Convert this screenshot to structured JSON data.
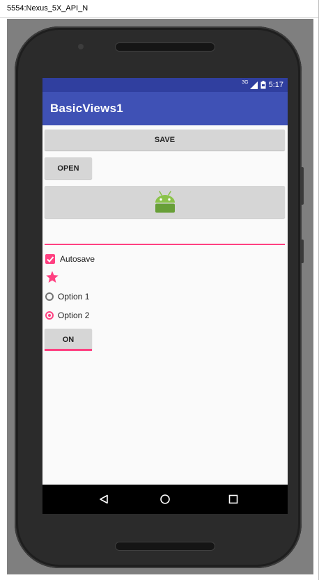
{
  "window": {
    "title": "5554:Nexus_5X_API_N"
  },
  "status_bar": {
    "network_label": "3G",
    "time": "5:17"
  },
  "app": {
    "title": "BasicViews1",
    "save_button_label": "SAVE",
    "open_button_label": "OPEN",
    "image_button_icon": "android-robot-icon",
    "edit_text_value": "",
    "checkbox": {
      "label": "Autosave",
      "checked": true
    },
    "star_icon": "star-icon",
    "radio_options": [
      {
        "label": "Option 1",
        "checked": false
      },
      {
        "label": "Option 2",
        "checked": true
      }
    ],
    "toggle_button_label": "ON"
  },
  "nav_bar": {
    "icons": [
      "back-icon",
      "home-icon",
      "recents-icon"
    ]
  },
  "colors": {
    "status_bar": "#303f9f",
    "app_bar": "#3f51b5",
    "accent": "#ff4081",
    "screen_bg": "#fafafa",
    "button_bg": "#d6d6d6"
  }
}
